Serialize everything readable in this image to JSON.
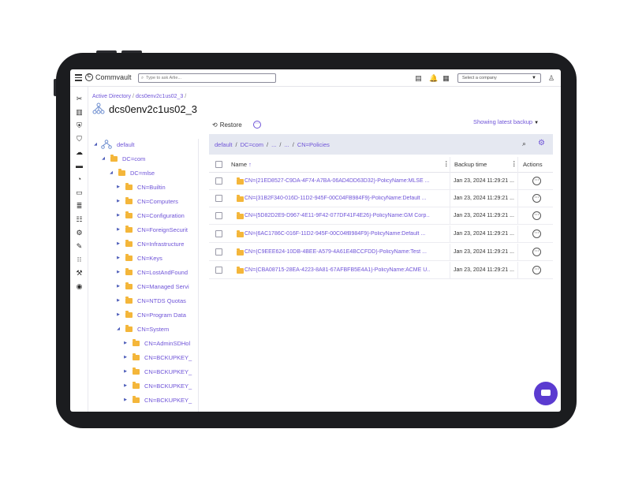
{
  "header": {
    "brand": "Commvault",
    "search_placeholder": "Type to ask Arlie...",
    "company_select": "Select a company"
  },
  "breadcrumb": {
    "root": "Active Directory",
    "current": "dcs0env2c1us02_3"
  },
  "page_title": "dcs0env2c1us02_3",
  "toolbar": {
    "restore": "Restore",
    "showing": "Showing latest backup"
  },
  "path": [
    "default",
    "DC=com",
    "...",
    "...",
    "CN=Policies"
  ],
  "tree": [
    {
      "label": "default",
      "level": 0
    },
    {
      "label": "DC=com",
      "level": 1
    },
    {
      "label": "DC=mlse",
      "level": 2
    },
    {
      "label": "CN=Builtin",
      "level": 3
    },
    {
      "label": "CN=Computers",
      "level": 3
    },
    {
      "label": "CN=Configuration",
      "level": 3
    },
    {
      "label": "CN=ForeignSecurit",
      "level": 3
    },
    {
      "label": "CN=Infrastructure",
      "level": 3
    },
    {
      "label": "CN=Keys",
      "level": 3
    },
    {
      "label": "CN=LostAndFound",
      "level": 3
    },
    {
      "label": "CN=Managed Servi",
      "level": 3
    },
    {
      "label": "CN=NTDS Quotas",
      "level": 3
    },
    {
      "label": "CN=Program Data",
      "level": 3
    },
    {
      "label": "CN=System",
      "level": 3
    },
    {
      "label": "CN=AdminSDHol",
      "level": 4
    },
    {
      "label": "CN=BCKUPKEY_",
      "level": 4
    },
    {
      "label": "CN=BCKUPKEY_",
      "level": 4
    },
    {
      "label": "CN=BCKUPKEY_",
      "level": 4
    },
    {
      "label": "CN=BCKUPKEY_",
      "level": 4
    }
  ],
  "table": {
    "col_name": "Name",
    "col_time": "Backup time",
    "col_actions": "Actions",
    "rows": [
      {
        "name": "CN={21ED8527-C9DA-4F74-A7BA-06AD4DD63D32}-PolicyName:MLSE ...",
        "time": "Jan 23, 2024 11:29:21 ..."
      },
      {
        "name": "CN={31B2F340-016D-11D2-945F-00C04FB984F9}-PolicyName:Default ...",
        "time": "Jan 23, 2024 11:29:21 ..."
      },
      {
        "name": "CN={5D82D2E9-D967-4E11-9F42-077DF41F4E26}-PolicyName:GM Corp...",
        "time": "Jan 23, 2024 11:29:21 ..."
      },
      {
        "name": "CN={6AC1786C-016F-11D2-945F-00C04fB984F9}-PolicyName:Default ...",
        "time": "Jan 23, 2024 11:29:21 ..."
      },
      {
        "name": "CN={C9EEE624-10DB-4BEE-A579-4A61E4BCCFDD}-PolicyName:Test ...",
        "time": "Jan 23, 2024 11:29:21 ..."
      },
      {
        "name": "CN={CBA08715-28EA-4223-8A81-67AFBFB5E4A1}-PolicyName:ACME U...",
        "time": "Jan 23, 2024 11:29:21 ..."
      }
    ]
  },
  "colors": {
    "accent": "#6f54d8",
    "folder": "#f4b63a",
    "pathbar": "#e5e8f1",
    "chat": "#5b3bd0"
  }
}
